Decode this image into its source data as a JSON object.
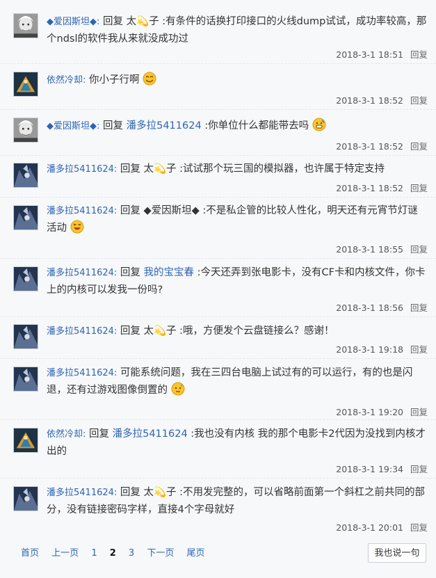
{
  "posts": [
    {
      "author": "◆爱因斯坦◆:",
      "reply_word": "回复",
      "target": "太💫子",
      "text": ":有条件的话换打印接口的火线dump试试，成功率较高，那个ndsl的软件我从来就没成功过",
      "time": "2018-3-1 18:51",
      "reply": "回复"
    },
    {
      "author": "依然冷却:",
      "text": "你小子行啊",
      "time": "2018-3-1 18:52",
      "reply": "回复",
      "emoji": "smile-emoji"
    },
    {
      "author": "◆爱因斯坦◆:",
      "reply_word": "回复",
      "target": "潘多拉5411624",
      "text": ":你单位什么都能带去吗",
      "time": "2018-3-1 18:52",
      "reply": "回复",
      "emoji": "grin-emoji"
    },
    {
      "author": "潘多拉5411624:",
      "reply_word": "回复",
      "target": "太💫子",
      "text": ":试试那个玩三国的模拟器，也许属于特定支持",
      "time": "2018-3-1 18:52",
      "reply": "回复"
    },
    {
      "author": "潘多拉5411624:",
      "reply_word": "回复",
      "target": "◆爱因斯坦◆",
      "text": ":不是私企管的比较人性化，明天还有元宵节灯谜活动",
      "time": "2018-3-1 18:55",
      "reply": "回复",
      "emoji": "laugh-emoji"
    },
    {
      "author": "潘多拉5411624:",
      "reply_word": "回复",
      "target": "我的宝宝春",
      "text": ":今天还弄到张电影卡，没有CF卡和内核文件，你卡上的内核可以发我一份吗?",
      "time": "2018-3-1 18:56",
      "reply": "回复"
    },
    {
      "author": "潘多拉5411624:",
      "reply_word": "回复",
      "target": "太💫子",
      "text": ":哦，方便发个云盘链接么？感谢！",
      "time": "2018-3-1 19:18",
      "reply": "回复"
    },
    {
      "author": "潘多拉5411624:",
      "text": "可能系统问题，我在三四台电脑上试过有的可以运行，有的也是闪退，还有过游戏图像倒置的",
      "time": "2018-3-1 19:20",
      "reply": "回复",
      "emoji": "sweat-emoji"
    },
    {
      "author": "依然冷却:",
      "reply_word": "回复",
      "target": "潘多拉5411624",
      "text": ":我也没有内核 我的那个电影卡2代因为没找到内核才出的",
      "time": "2018-3-1 19:34",
      "reply": "回复"
    },
    {
      "author": "潘多拉5411624:",
      "reply_word": "回复",
      "target": "太💫子",
      "text": ":不用发完整的，可以省略前面第一个斜杠之前共同的部分，没有链接密码字样，直接4个字母就好",
      "time": "2018-3-1 20:01",
      "reply": "回复"
    }
  ],
  "pager": {
    "first": "首页",
    "prev": "上一页",
    "p1": "1",
    "p2": "2",
    "p3": "3",
    "next": "下一页",
    "last": "尾页"
  },
  "say_button": "我也说一句"
}
